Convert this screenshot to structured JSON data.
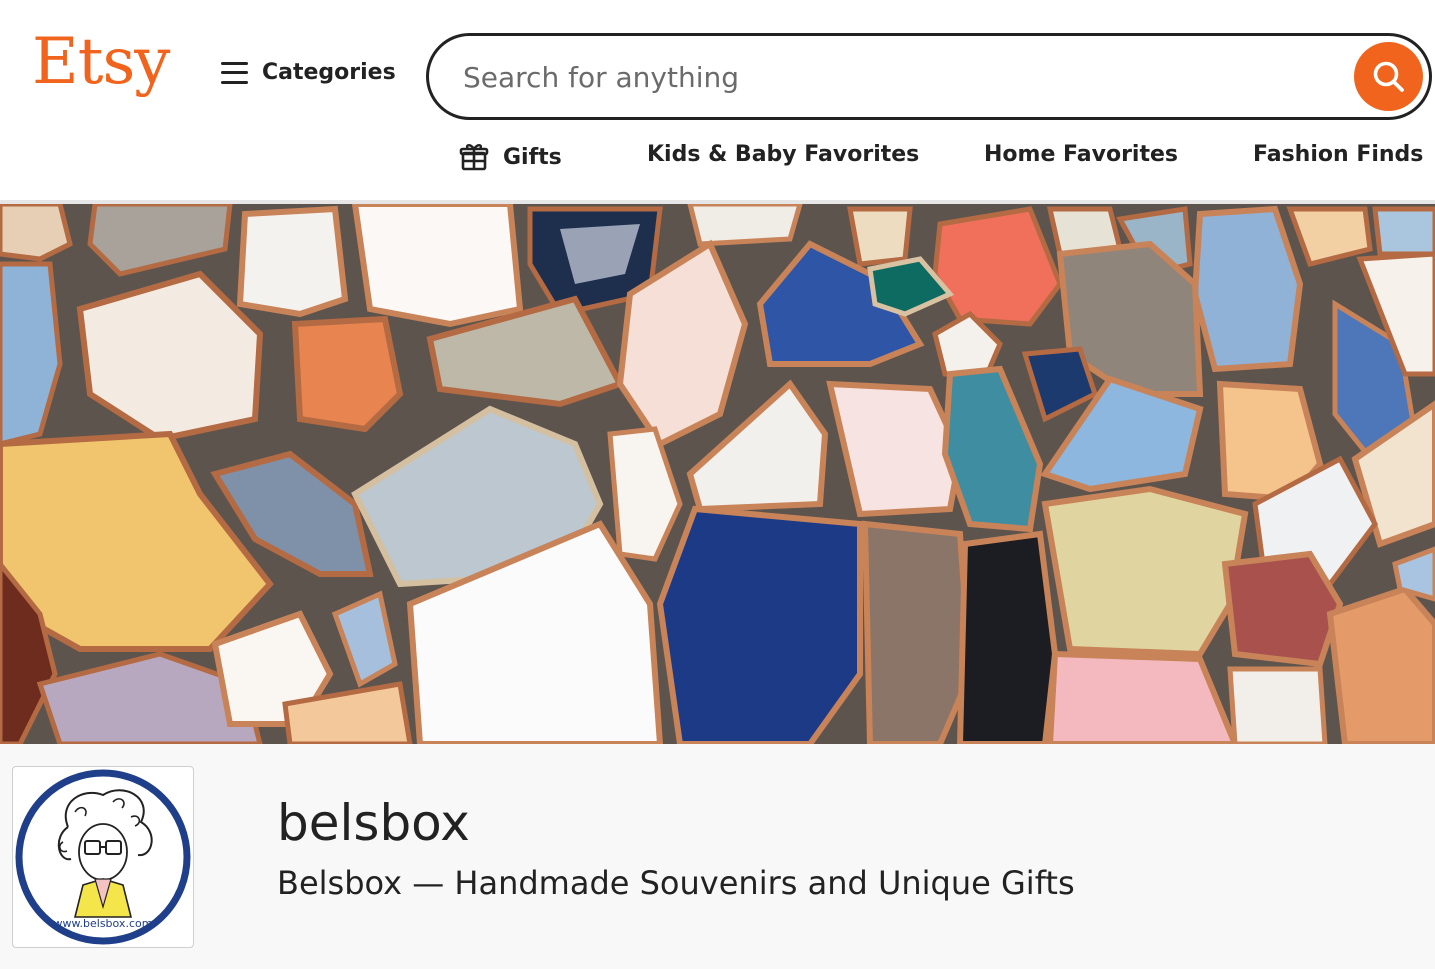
{
  "header": {
    "logo": "Etsy",
    "categories_label": "Categories",
    "search": {
      "placeholder": "Search for anything",
      "value": ""
    },
    "nav": [
      {
        "label": "Gifts",
        "icon": "gift-icon"
      },
      {
        "label": "Kids & Baby Favorites"
      },
      {
        "label": "Home Favorites"
      },
      {
        "label": "Fashion Finds"
      }
    ]
  },
  "colors": {
    "brand": "#f1641e",
    "text": "#222222",
    "placeholder": "#6b6b6b",
    "logo_ring": "#1f3f8a"
  },
  "banner": {
    "image": "ceramic-tile-mosaic"
  },
  "shop": {
    "name": "belsbox",
    "title": "Belsbox — Handmade Souvenirs and Unique Gifts",
    "logo_text": "www.belsbox.com"
  }
}
